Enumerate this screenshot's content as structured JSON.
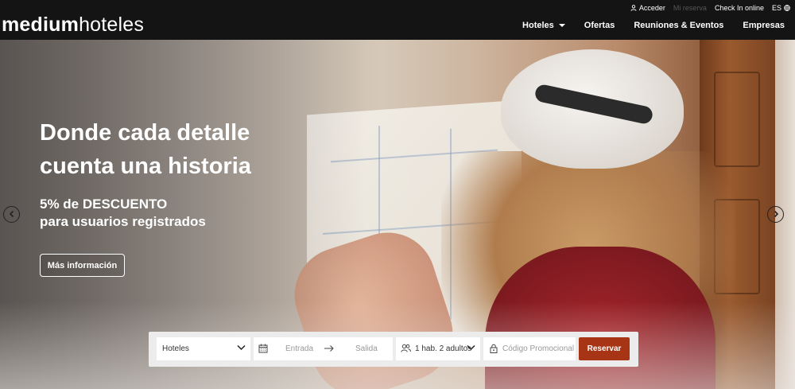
{
  "header": {
    "logo_bold": "medium",
    "logo_light": "hoteles",
    "topbar": {
      "login": "Acceder",
      "my_booking": "Mi reserva",
      "checkin": "Check In online",
      "language": "ES"
    },
    "nav": {
      "hotels": "Hoteles",
      "offers": "Ofertas",
      "meetings": "Reuniones & Eventos",
      "companies": "Empresas"
    }
  },
  "hero": {
    "headline_line1": "Donde cada detalle",
    "headline_line2": "cuenta una historia",
    "discount_line1": "5% de DESCUENTO",
    "discount_line2": "para usuarios registrados",
    "cta_label": "Más información"
  },
  "booking": {
    "hotel_select": "Hoteles",
    "checkin_placeholder": "Entrada",
    "checkout_placeholder": "Salida",
    "guests": "1 hab. 2 adultos",
    "promo_placeholder": "Código Promocional",
    "submit_label": "Reservar"
  },
  "colors": {
    "header_bg": "#141414",
    "accent": "#a73414",
    "booking_bg": "#ececec"
  },
  "icons": [
    "user-icon",
    "globe-icon",
    "caret-down-icon",
    "chevron-left-icon",
    "chevron-right-icon",
    "calendar-icon",
    "arrow-right-icon",
    "users-icon",
    "lock-icon",
    "chevron-down-icon"
  ]
}
